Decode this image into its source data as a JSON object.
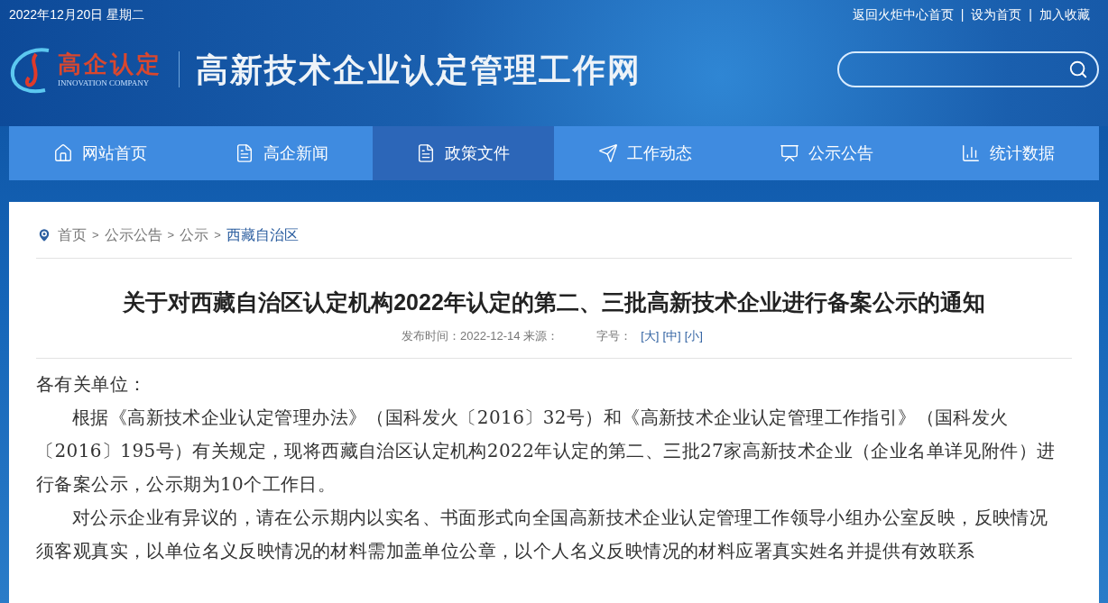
{
  "top_bar": {
    "date": "2022年12月20日 星期二",
    "links": [
      "返回火炬中心首页",
      "设为首页",
      "加入收藏"
    ],
    "separator": "|"
  },
  "logo": {
    "mark": "高企认定",
    "subtitle": "INNOVATION COMPANY"
  },
  "site_title": "高新技术企业认定管理工作网",
  "nav": [
    {
      "label": "网站首页",
      "selected": false
    },
    {
      "label": "高企新闻",
      "selected": false
    },
    {
      "label": "政策文件",
      "selected": true
    },
    {
      "label": "工作动态",
      "selected": false
    },
    {
      "label": "公示公告",
      "selected": false
    },
    {
      "label": "统计数据",
      "selected": false
    }
  ],
  "breadcrumb": {
    "items": [
      "首页",
      "公示公告",
      "公示",
      "西藏自治区"
    ],
    "separator": ">"
  },
  "article": {
    "title": "关于对西藏自治区认定机构2022年认定的第二、三批高新技术企业进行备案公示的通知",
    "meta": {
      "published": "发布时间：2022-12-14 来源：",
      "font_size_label": "字号：",
      "sizes": [
        "[大]",
        "[中]",
        "[小]"
      ]
    },
    "salutation": "各有关单位：",
    "paragraphs": [
      "根据《高新技术企业认定管理办法》（国科发火〔2016〕32号）和《高新技术企业认定管理工作指引》（国科发火〔2016〕195号）有关规定，现将西藏自治区认定机构2022年认定的第二、三批27家高新技术企业（企业名单详见附件）进行备案公示，公示期为10个工作日。",
      "对公示企业有异议的，请在公示期内以实名、书面形式向全国高新技术企业认定管理工作领导小组办公室反映，反映情况须客观真实，以单位名义反映情况的材料需加盖单位公章，以个人名义反映情况的材料应署真实姓名并提供有效联系"
    ]
  }
}
